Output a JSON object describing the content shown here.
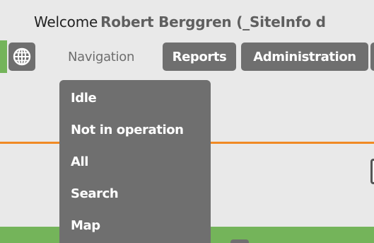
{
  "header": {
    "welcome_prefix": "Welcome",
    "user_text": "Robert Berggren (_SiteInfo d"
  },
  "nav": {
    "globe_icon": "globe-icon",
    "navigation_label": "Navigation",
    "reports_label": "Reports",
    "administration_label": "Administration"
  },
  "dropdown": {
    "items": [
      {
        "label": "Idle"
      },
      {
        "label": "Not in operation"
      },
      {
        "label": "All"
      },
      {
        "label": "Search"
      },
      {
        "label": "Map"
      }
    ]
  },
  "colors": {
    "button_bg": "#6f6f6f",
    "accent_orange": "#f08a24",
    "accent_green": "#74b45a"
  }
}
